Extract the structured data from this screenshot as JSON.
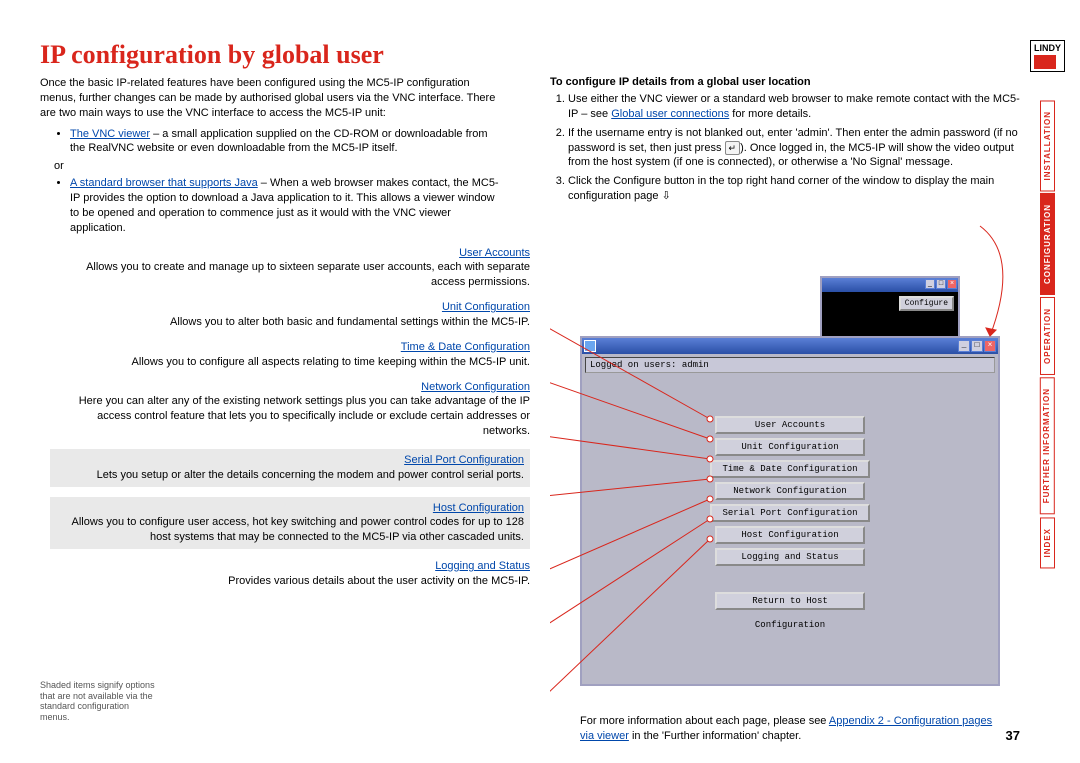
{
  "page_number": "37",
  "logo_text": "LINDY",
  "title": "IP configuration by global user",
  "intro": "Once the basic IP-related features have been configured using the MC5-IP configuration menus, further changes can be made by authorised global users via the VNC interface. There are two main ways to use the VNC interface to access the MC5-IP unit:",
  "bullet1_link": "The VNC viewer",
  "bullet1_rest": " – a small application supplied on the CD-ROM or downloadable from the RealVNC website or even downloadable from the MC5-IP itself.",
  "or": "or",
  "bullet2_link": "A standard browser that supports Java",
  "bullet2_rest": " – When a web browser makes contact, the MC5-IP provides the option to download a Java application to it. This allows a viewer window to be opened and operation to commence just as it would with the VNC viewer application.",
  "right_heading": "To configure IP details from a global user location",
  "step1a": "Use either the VNC viewer or a standard web browser to make remote contact with the MC5-IP – see ",
  "step1_link": "Global user connections",
  "step1b": " for more details.",
  "step2a": "If the username entry is not blanked out, enter 'admin'. Then enter the admin password (if no password is set, then just press ",
  "step2b": "). Once logged in, the MC5-IP will show the video output from the host system (if one is connected), or otherwise a 'No Signal' message.",
  "step3": "Click the Configure button in the top right hand corner of the window to display the main configuration page ⇩",
  "enter_glyph": "↵",
  "descs": [
    {
      "t": "User Accounts",
      "d": "Allows you to create and manage up to sixteen separate user accounts, each with separate access permissions.",
      "shaded": false
    },
    {
      "t": "Unit Configuration",
      "d": "Allows you to alter both basic and fundamental settings within the MC5-IP.",
      "shaded": false
    },
    {
      "t": "Time & Date Configuration",
      "d": "Allows you to configure all aspects relating to time keeping within the MC5-IP unit.",
      "shaded": false
    },
    {
      "t": "Network Configuration",
      "d": "Here you can alter any of the existing network settings plus you can take advantage of the IP access control feature that lets you to specifically include or exclude certain addresses or networks.",
      "shaded": false
    },
    {
      "t": "Serial Port Configuration",
      "d": "Lets you setup or alter the details concerning the modem and power control serial ports.",
      "shaded": true
    },
    {
      "t": "Host Configuration",
      "d": "Allows you to configure user access, hot key switching and power control codes for up to 128 host systems that may be connected to the MC5-IP via other cascaded units.",
      "shaded": true
    },
    {
      "t": "Logging and Status",
      "d": "Provides various details about the user activity on the MC5-IP.",
      "shaded": false
    }
  ],
  "note": "Shaded items signify options that are not available via the standard configuration menus.",
  "vnc": {
    "status": "Logged on users: admin",
    "buttons": [
      "User Accounts",
      "Unit Configuration",
      "Time & Date Configuration",
      "Network Configuration",
      "Serial Port Configuration",
      "Host Configuration",
      "Logging and Status"
    ],
    "return": "Return to Host",
    "footer": "Configuration",
    "configure_btn": "Configure"
  },
  "footlink_a": "For more information about each page, please see ",
  "footlink_link": "Appendix 2 - Configuration pages via viewer",
  "footlink_b": " in the 'Further information' chapter.",
  "tabs": [
    "INSTALLATION",
    "CONFIGURATION",
    "OPERATION",
    "FURTHER INFORMATION",
    "INDEX"
  ],
  "active_tab": 1
}
